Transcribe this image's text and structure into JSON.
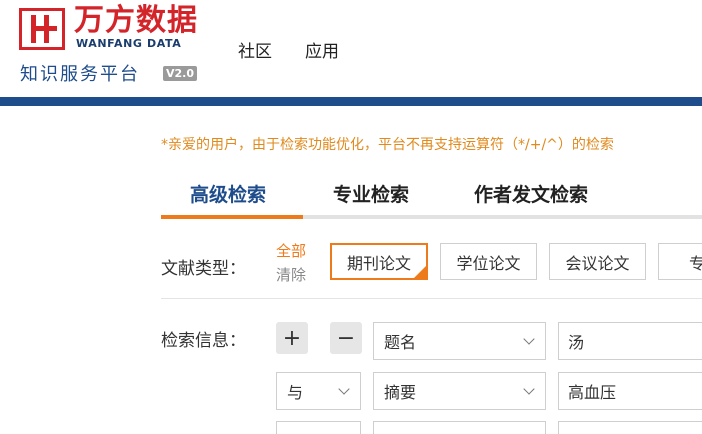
{
  "brand": {
    "title": "万方数据",
    "subtitle": "WANFANG DATA",
    "tagline": "知识服务平台",
    "version": "V2.0",
    "color_red": "#d3242a",
    "color_blue": "#1f4d8c"
  },
  "nav": [
    "社区",
    "应用"
  ],
  "notice": "*亲爱的用户，由于检索功能优化，平台不再支持运算符（*/+/^）的检索",
  "tabs": [
    {
      "label": "高级检索",
      "active": true
    },
    {
      "label": "专业检索",
      "active": false
    },
    {
      "label": "作者发文检索",
      "active": false
    }
  ],
  "doc_type": {
    "label": "文献类型：",
    "select_all": "全部",
    "clear": "清除",
    "types": [
      {
        "label": "期刊论文",
        "selected": true
      },
      {
        "label": "学位论文",
        "selected": false
      },
      {
        "label": "会议论文",
        "selected": false
      },
      {
        "label": "专",
        "selected": false
      }
    ]
  },
  "search": {
    "label": "检索信息：",
    "add_symbol": "+",
    "remove_symbol": "−",
    "rows": [
      {
        "field": "题名",
        "value": "汤"
      },
      {
        "operator": "与",
        "field": "摘要",
        "value": "高血压"
      }
    ]
  },
  "accent_color": "#ee7b1b"
}
